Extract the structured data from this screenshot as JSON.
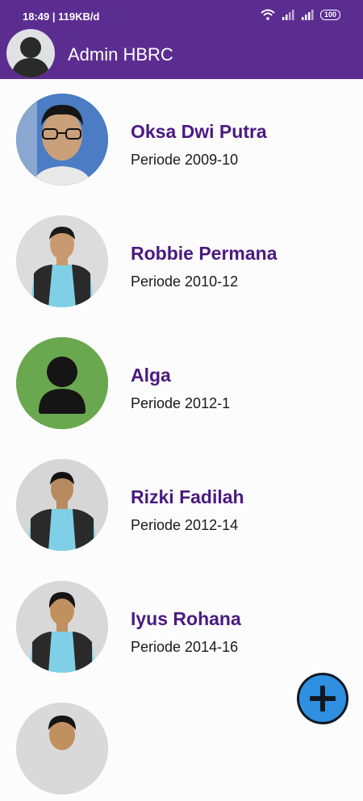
{
  "status_bar": {
    "text": "18:49 | 119KB/d",
    "battery": "100",
    "icons": [
      "wifi-icon",
      "signal-icon",
      "signal-icon",
      "battery-icon"
    ]
  },
  "app_bar": {
    "title": "Admin HBRC",
    "avatar_icon": "person-silhouette-icon"
  },
  "members": [
    {
      "name": "Oksa Dwi Putra",
      "period": "Periode 2009-10"
    },
    {
      "name": "Robbie Permana",
      "period": "Periode 2010-12"
    },
    {
      "name": "Alga",
      "period": "Periode 2012-1"
    },
    {
      "name": "Rizki Fadilah",
      "period": "Periode 2012-14"
    },
    {
      "name": "Iyus Rohana",
      "period": "Periode 2014-16"
    }
  ],
  "fab": {
    "icon": "plus-icon"
  },
  "colors": {
    "header": "#5c2d91",
    "name_text": "#4a1a80",
    "placeholder_avatar": "#6aa84f",
    "fab": "#2f8fe0"
  }
}
